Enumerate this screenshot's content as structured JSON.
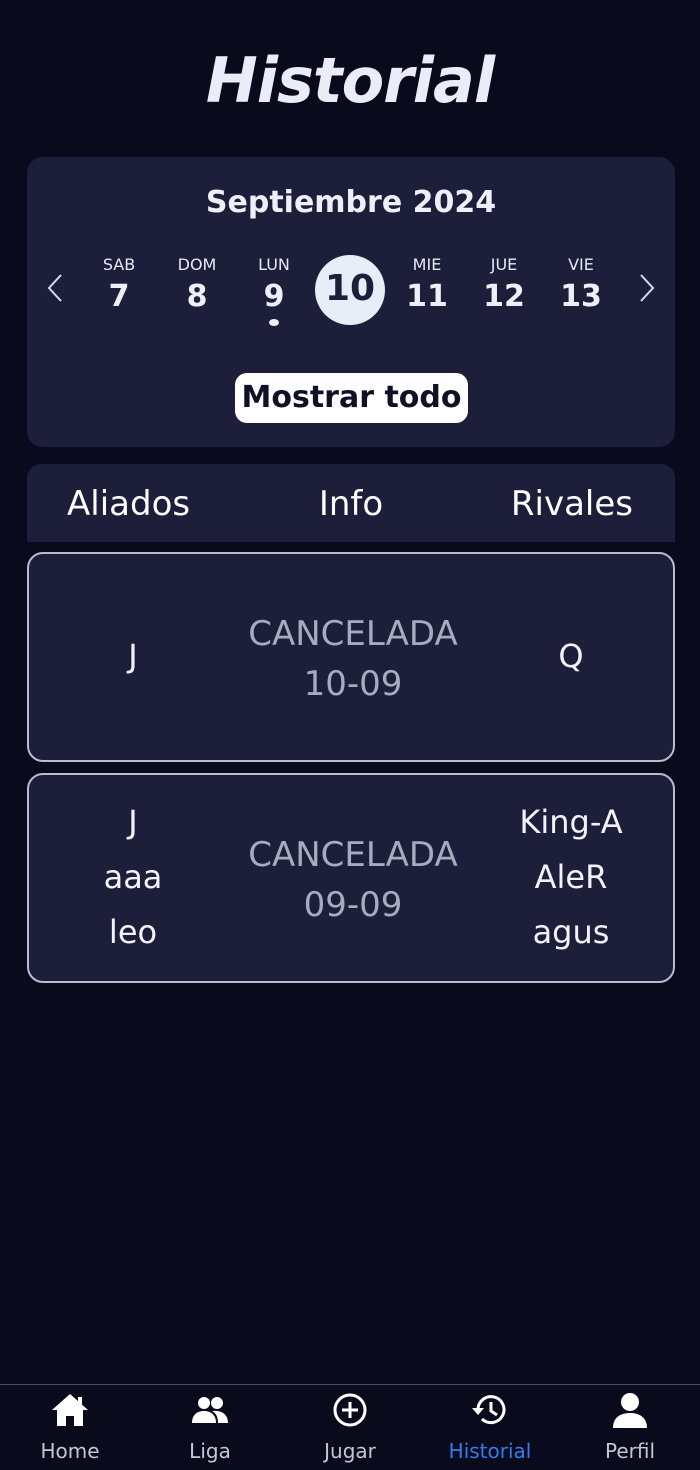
{
  "page": {
    "title": "Historial"
  },
  "calendar": {
    "month": "Septiembre 2024",
    "days": [
      {
        "name": "SAB",
        "num": "7"
      },
      {
        "name": "DOM",
        "num": "8"
      },
      {
        "name": "LUN",
        "num": "9",
        "has_event": true
      },
      {
        "name": "",
        "num": "10",
        "selected": true
      },
      {
        "name": "MIE",
        "num": "11"
      },
      {
        "name": "JUE",
        "num": "12"
      },
      {
        "name": "VIE",
        "num": "13"
      }
    ],
    "show_all_label": "Mostrar todo",
    "prev_icon": "chevron-left-icon",
    "next_icon": "chevron-right-icon"
  },
  "table_header": {
    "allies": "Aliados",
    "info": "Info",
    "rivals": "Rivales"
  },
  "matches": [
    {
      "allies": [
        "J"
      ],
      "status": "CANCELADA",
      "date": "10-09",
      "rivals": [
        "Q"
      ]
    },
    {
      "allies": [
        "J",
        "aaa",
        "leo"
      ],
      "status": "CANCELADA",
      "date": "09-09",
      "rivals": [
        "King-A",
        "AleR",
        "agus"
      ]
    }
  ],
  "nav": {
    "items": [
      {
        "label": "Home",
        "icon": "home-icon"
      },
      {
        "label": "Liga",
        "icon": "group-icon"
      },
      {
        "label": "Jugar",
        "icon": "plus-circle-icon"
      },
      {
        "label": "Historial",
        "icon": "history-icon",
        "active": true
      },
      {
        "label": "Perfil",
        "icon": "person-icon"
      }
    ]
  },
  "colors": {
    "background": "#090b1d",
    "card": "#1d1f3a",
    "accent": "#2f7df0",
    "muted_text": "#a8abbe"
  }
}
